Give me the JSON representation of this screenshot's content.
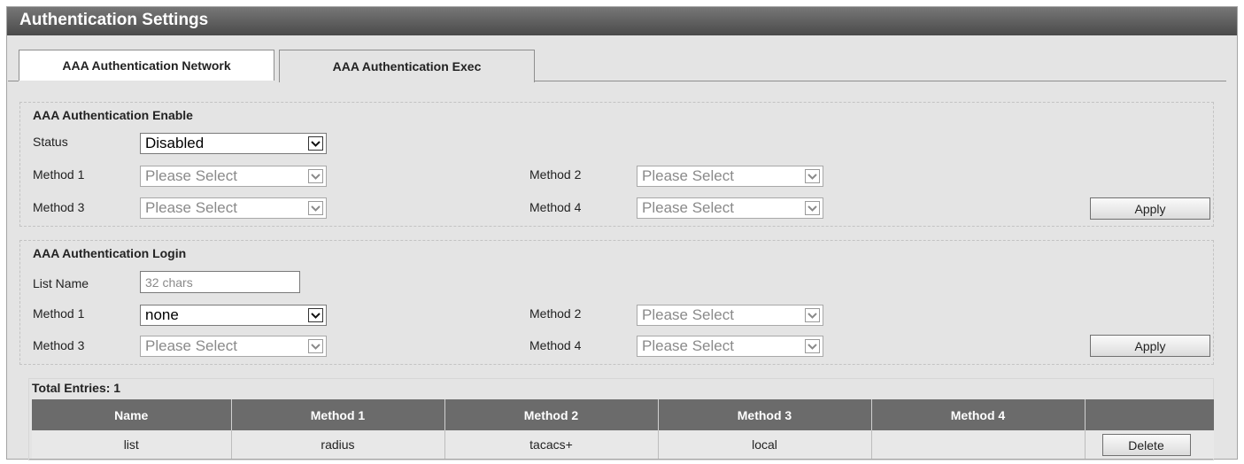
{
  "title": "Authentication Settings",
  "tabs": [
    {
      "label": "AAA Authentication Network"
    },
    {
      "label": "AAA Authentication Exec"
    }
  ],
  "enable_section": {
    "title": "AAA Authentication Enable",
    "status_label": "Status",
    "status_value": "Disabled",
    "method1_label": "Method 1",
    "method1_value": "Please Select",
    "method2_label": "Method 2",
    "method2_value": "Please Select",
    "method3_label": "Method 3",
    "method3_value": "Please Select",
    "method4_label": "Method 4",
    "method4_value": "Please Select",
    "apply_label": "Apply"
  },
  "login_section": {
    "title": "AAA Authentication Login",
    "list_name_label": "List Name",
    "list_name_placeholder": "32 chars",
    "method1_label": "Method 1",
    "method1_value": "none",
    "method2_label": "Method 2",
    "method2_value": "Please Select",
    "method3_label": "Method 3",
    "method3_value": "Please Select",
    "method4_label": "Method 4",
    "method4_value": "Please Select",
    "apply_label": "Apply"
  },
  "table": {
    "total_entries": "Total Entries: 1",
    "headers": [
      "Name",
      "Method 1",
      "Method 2",
      "Method 3",
      "Method 4",
      ""
    ],
    "rows": [
      {
        "name": "list",
        "method1": "radius",
        "method2": "tacacs+",
        "method3": "local",
        "method4": "",
        "action_label": "Delete"
      }
    ]
  },
  "icons": {
    "dropdown": "chevron-down-icon"
  },
  "colors": {
    "titlebar": "#5a5a5a",
    "panel_bg": "#e4e4e4",
    "table_header": "#6b6b6b"
  }
}
